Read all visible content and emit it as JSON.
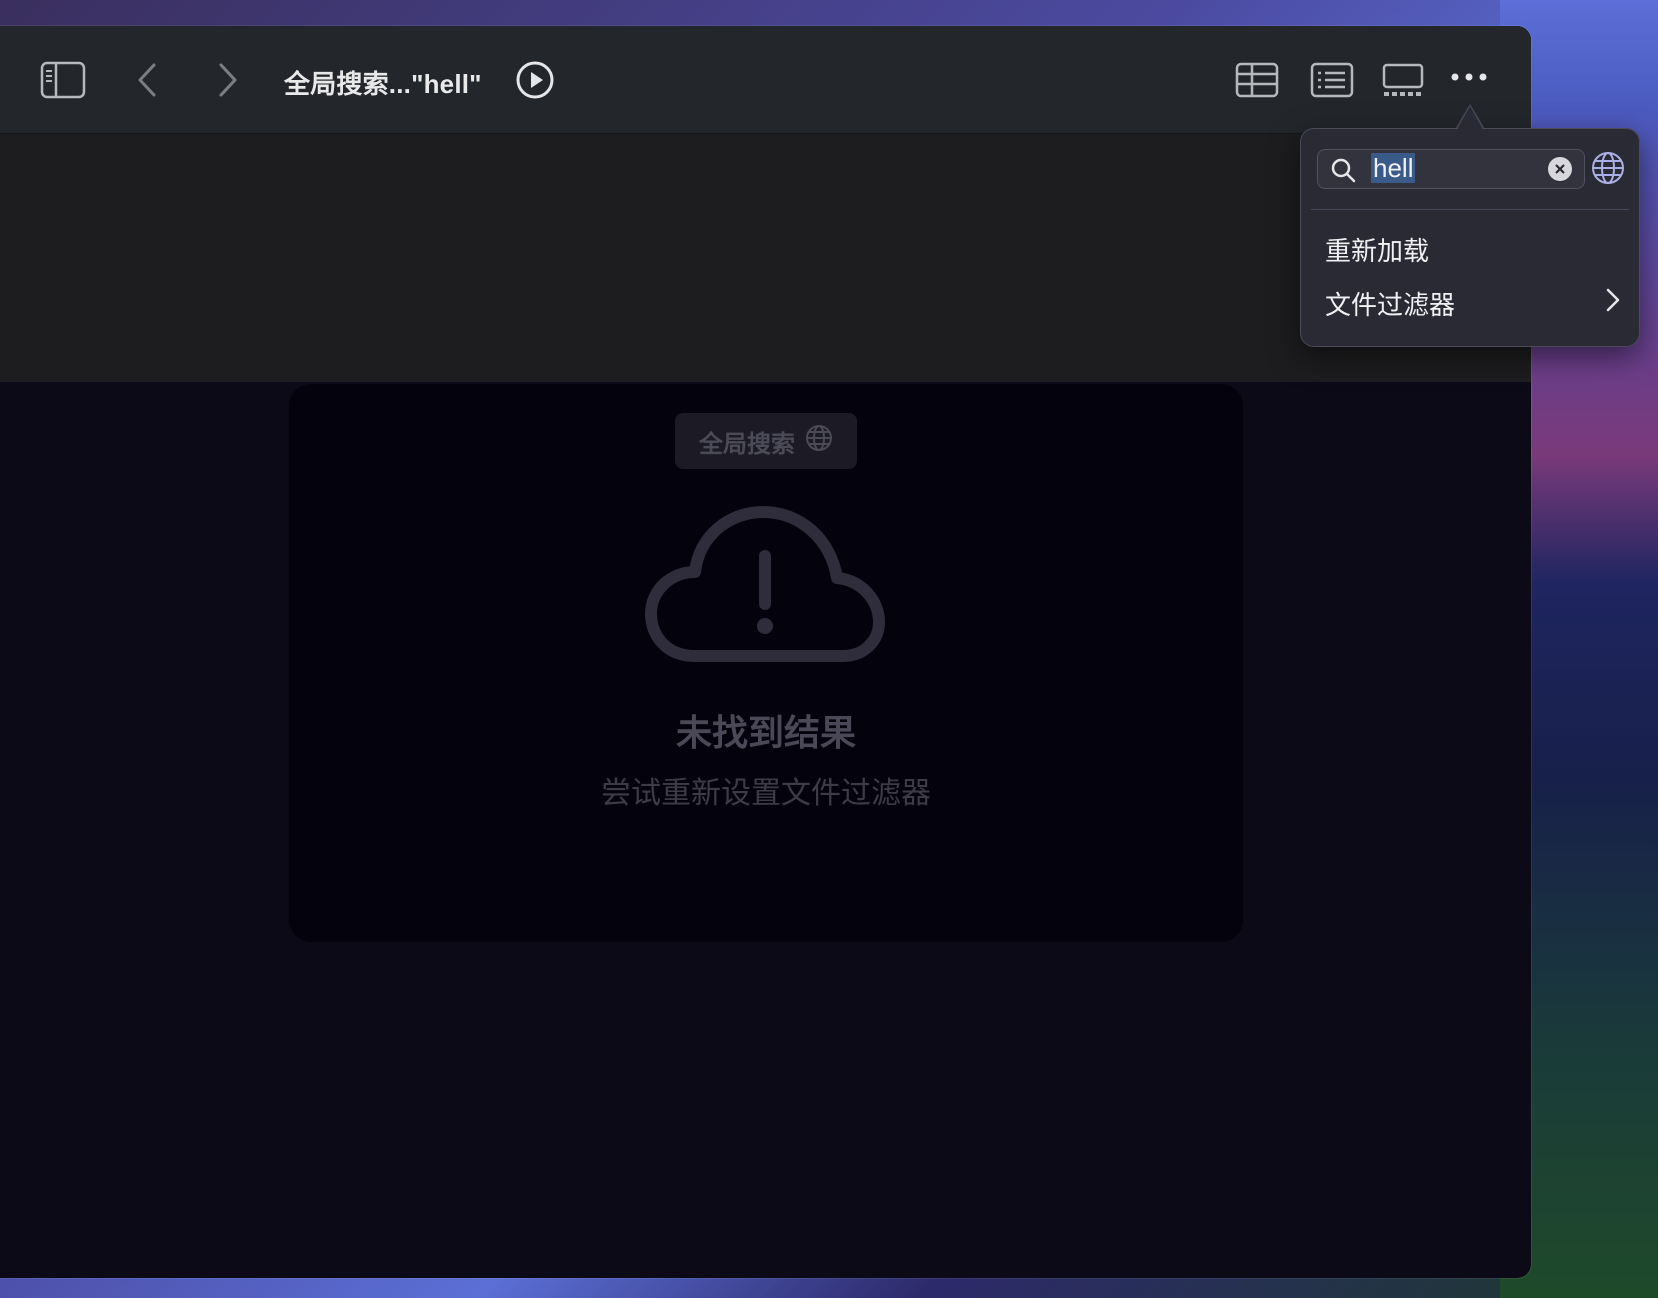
{
  "toolbar": {
    "title": "全局搜索...\"hell\"",
    "icons": [
      "sidebar-toggle-icon",
      "back-chevron-icon",
      "forward-chevron-icon",
      "play-icon",
      "table-view-icon",
      "list-view-icon",
      "gallery-view-icon",
      "more-icon"
    ]
  },
  "card": {
    "badge_label": "全局搜索",
    "empty_title": "未找到结果",
    "empty_subtitle": "尝试重新设置文件过滤器"
  },
  "popover": {
    "search_value": "hell",
    "menu": {
      "reload": "重新加载",
      "file_filter": "文件过滤器"
    }
  },
  "colors": {
    "toolbar_bg": "#23272b",
    "content_bg": "#0c0a16",
    "card_bg": "#04030d",
    "popover_bg": "#2a2a34"
  }
}
